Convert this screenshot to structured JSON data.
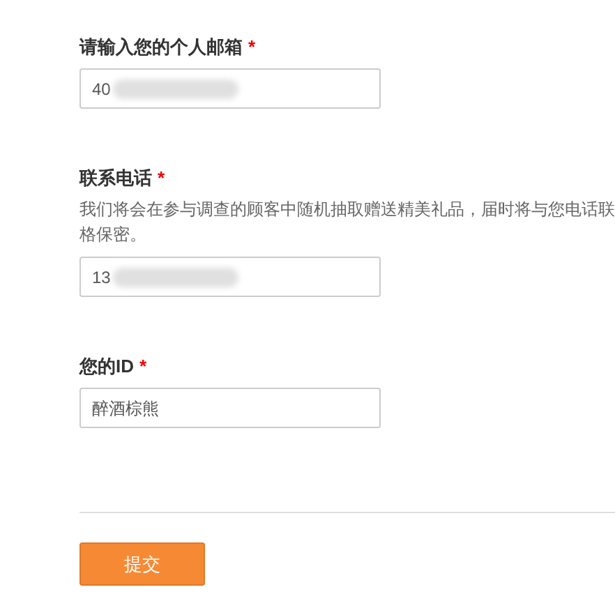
{
  "fields": [
    {
      "label": "请输入您的个人邮箱",
      "required_mark": "*",
      "value": "40",
      "redacted": true
    },
    {
      "label": "联系电话",
      "required_mark": "*",
      "help_lines": [
        "我们将会在参与调查的顾客中随机抽取赠送精美礼品，届时将与您电话联",
        "格保密。"
      ],
      "value": "13",
      "redacted": true
    },
    {
      "label": "您的ID",
      "required_mark": "*",
      "value": "醉酒棕熊",
      "redacted": false
    }
  ],
  "submit": "提交"
}
